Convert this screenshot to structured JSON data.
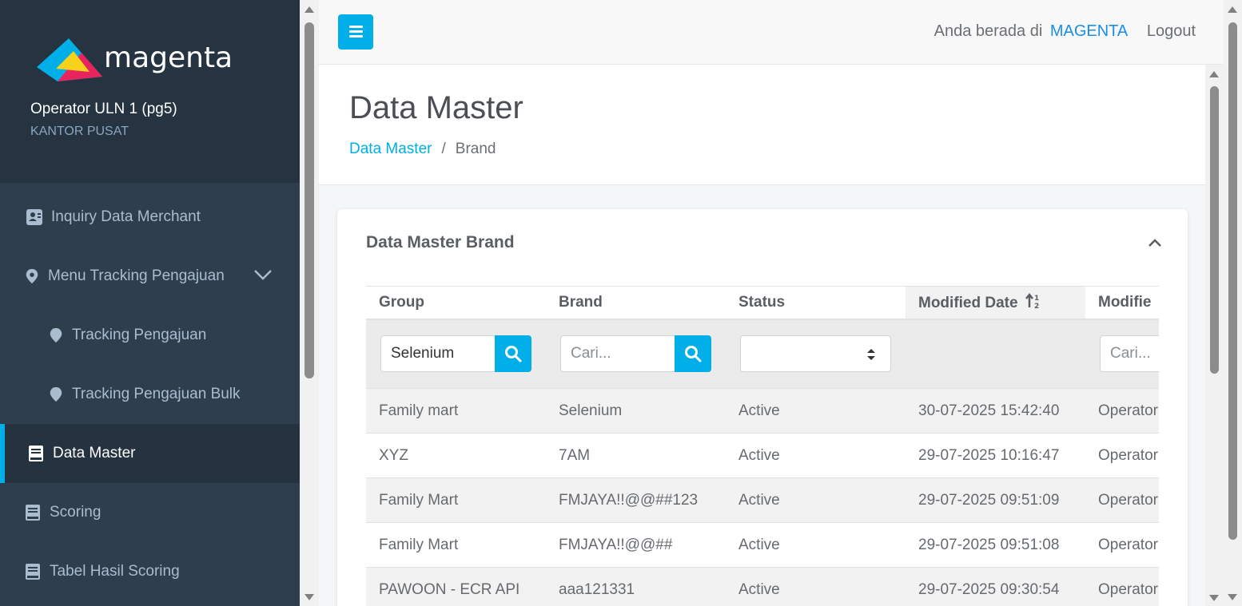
{
  "brand": {
    "logo_text": "magenta",
    "accent_color": "#00aee8",
    "link_color": "#1a8ee6"
  },
  "sidebar": {
    "user_name": "Operator ULN 1 (pg5)",
    "user_office": "KANTOR PUSAT",
    "items": [
      {
        "label": "Inquiry Data Merchant",
        "icon": "id-card-icon"
      },
      {
        "label": "Menu Tracking Pengajuan",
        "icon": "map-pin-icon"
      },
      {
        "label": "Tracking Pengajuan",
        "icon": "map-pin-icon"
      },
      {
        "label": "Tracking Pengajuan Bulk",
        "icon": "map-pin-icon"
      },
      {
        "label": "Data Master",
        "icon": "book-icon"
      },
      {
        "label": "Scoring",
        "icon": "book-icon"
      },
      {
        "label": "Tabel Hasil Scoring",
        "icon": "book-icon"
      }
    ]
  },
  "topbar": {
    "location_prefix": "Anda berada di",
    "location_name": "MAGENTA",
    "logout_label": "Logout"
  },
  "page": {
    "title": "Data Master",
    "breadcrumb": [
      "Data Master",
      "Brand"
    ]
  },
  "card": {
    "title": "Data Master Brand"
  },
  "table": {
    "columns": [
      "Group",
      "Brand",
      "Status",
      "Modified Date",
      "Modifie"
    ],
    "filters": {
      "group_value": "Selenium",
      "brand_placeholder": "Cari...",
      "status_value": "",
      "modified_by_placeholder": "Cari..."
    },
    "rows": [
      [
        "Family mart",
        "Selenium",
        "Active",
        "30-07-2025 15:42:40",
        "Operator"
      ],
      [
        "XYZ",
        "7AM",
        "Active",
        "29-07-2025 10:16:47",
        "Operator"
      ],
      [
        "Family Mart",
        "FMJAYA!!@@##123",
        "Active",
        "29-07-2025 09:51:09",
        "Operator"
      ],
      [
        "Family Mart",
        "FMJAYA!!@@##",
        "Active",
        "29-07-2025 09:51:08",
        "Operator"
      ],
      [
        "PAWOON - ECR API",
        "aaa121331",
        "Active",
        "29-07-2025 09:30:54",
        "Operator"
      ]
    ]
  }
}
